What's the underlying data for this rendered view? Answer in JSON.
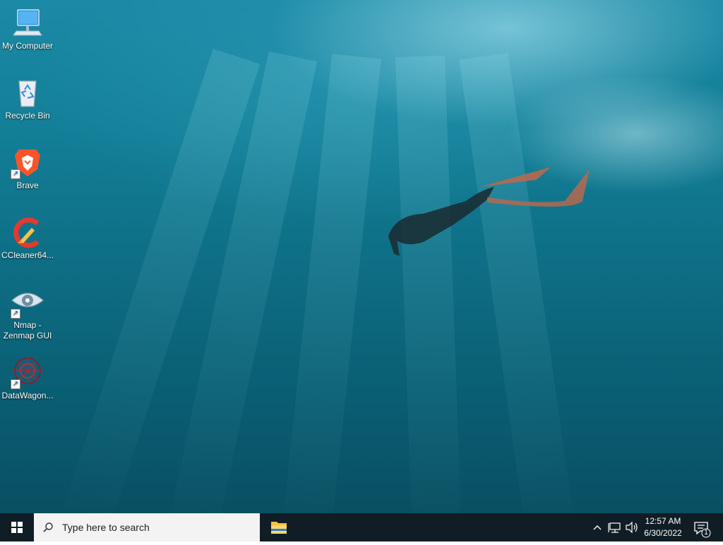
{
  "desktop": {
    "icons": [
      {
        "label": "My Computer",
        "icon": "computer-icon",
        "shortcut": false
      },
      {
        "label": "Recycle Bin",
        "icon": "recycle-bin-icon",
        "shortcut": false
      },
      {
        "label": "Brave",
        "icon": "brave-browser-icon",
        "shortcut": true
      },
      {
        "label": "CCleaner64...",
        "icon": "ccleaner-icon",
        "shortcut": false
      },
      {
        "label": "Nmap - Zenmap GUI",
        "icon": "zenmap-eye-icon",
        "shortcut": true
      },
      {
        "label": "DataWagon...",
        "icon": "datawagon-icon",
        "shortcut": true
      }
    ]
  },
  "taskbar": {
    "search_placeholder": "Type here to search",
    "pinned": [
      {
        "name": "File Explorer",
        "icon": "folder-icon"
      }
    ],
    "tray": {
      "icons": [
        "chevron-up-icon",
        "network-icon",
        "volume-icon"
      ],
      "time": "12:57 AM",
      "date": "6/30/2022",
      "notification_count": "1"
    }
  },
  "colors": {
    "taskbar_bg": "#101d25",
    "water_top": "#1c8aa6",
    "water_bottom": "#094f62"
  }
}
